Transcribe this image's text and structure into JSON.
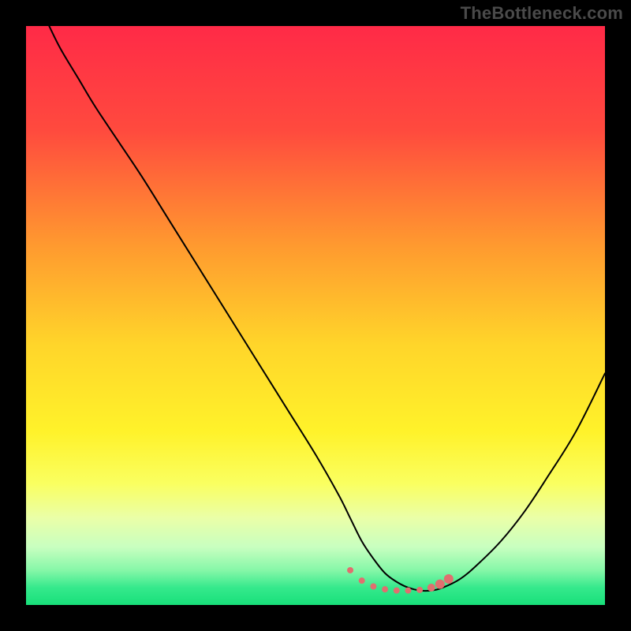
{
  "watermark": "TheBottleneck.com",
  "chart_data": {
    "type": "line",
    "title": "",
    "xlabel": "",
    "ylabel": "",
    "xlim": [
      0,
      100
    ],
    "ylim": [
      0,
      100
    ],
    "gradient_stops": [
      {
        "offset": 0,
        "color": "#ff2a47"
      },
      {
        "offset": 18,
        "color": "#ff4a3e"
      },
      {
        "offset": 38,
        "color": "#ff9a2f"
      },
      {
        "offset": 55,
        "color": "#ffd52a"
      },
      {
        "offset": 70,
        "color": "#fff22a"
      },
      {
        "offset": 79,
        "color": "#faff60"
      },
      {
        "offset": 85,
        "color": "#eaffa8"
      },
      {
        "offset": 90,
        "color": "#c8ffc0"
      },
      {
        "offset": 94,
        "color": "#86f7a8"
      },
      {
        "offset": 97,
        "color": "#35e98c"
      },
      {
        "offset": 100,
        "color": "#18e07a"
      }
    ],
    "series": [
      {
        "name": "bottleneck-curve",
        "x": [
          4,
          6,
          9,
          12,
          16,
          20,
          25,
          30,
          35,
          40,
          45,
          50,
          54,
          56,
          58,
          60,
          62,
          64,
          66,
          68,
          70,
          72,
          75,
          78,
          82,
          86,
          90,
          95,
          100
        ],
        "y": [
          100,
          96,
          91,
          86,
          80,
          74,
          66,
          58,
          50,
          42,
          34,
          26,
          19,
          15,
          11,
          8,
          5.5,
          4,
          3,
          2.5,
          2.5,
          3,
          4.5,
          7,
          11,
          16,
          22,
          30,
          40
        ]
      }
    ],
    "markers": {
      "name": "highlight-dots",
      "color": "#e06f6f",
      "points": [
        {
          "x": 56,
          "y": 6.0,
          "r": 4
        },
        {
          "x": 58,
          "y": 4.2,
          "r": 4
        },
        {
          "x": 60,
          "y": 3.2,
          "r": 4
        },
        {
          "x": 62,
          "y": 2.7,
          "r": 4
        },
        {
          "x": 64,
          "y": 2.5,
          "r": 4
        },
        {
          "x": 66,
          "y": 2.5,
          "r": 4
        },
        {
          "x": 68,
          "y": 2.6,
          "r": 4
        },
        {
          "x": 70,
          "y": 3.0,
          "r": 5
        },
        {
          "x": 71.5,
          "y": 3.6,
          "r": 6
        },
        {
          "x": 73,
          "y": 4.5,
          "r": 6
        }
      ]
    }
  }
}
